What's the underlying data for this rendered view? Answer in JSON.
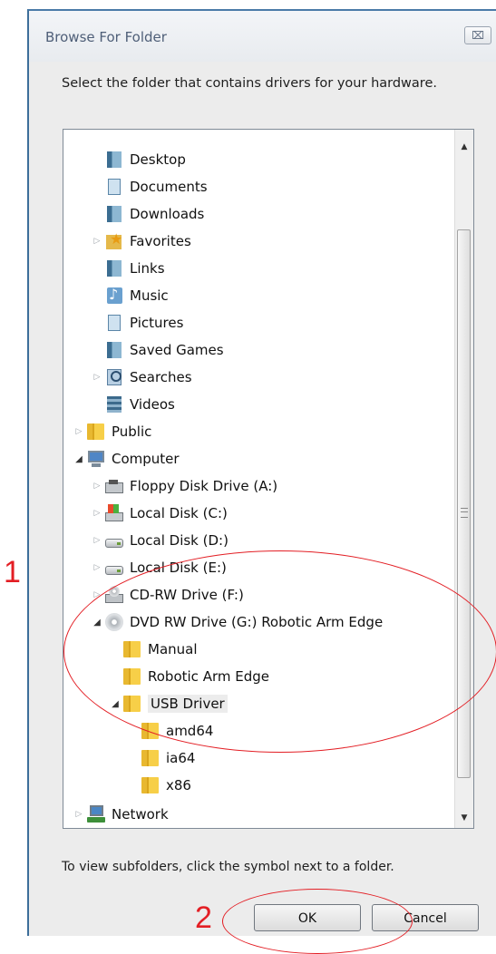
{
  "dialog": {
    "title": "Browse For Folder",
    "close_label": "⌧",
    "instruction": "Select the folder that contains drivers for your hardware.",
    "hint": "To view subfolders, click the symbol next to a folder.",
    "ok_label": "OK",
    "cancel_label": "Cancel"
  },
  "tree": {
    "items": [
      {
        "label": "Desktop",
        "icon": "library-icon"
      },
      {
        "label": "Documents",
        "icon": "documents-icon"
      },
      {
        "label": "Downloads",
        "icon": "library-icon"
      },
      {
        "label": "Favorites",
        "icon": "favorites-icon"
      },
      {
        "label": "Links",
        "icon": "library-icon"
      },
      {
        "label": "Music",
        "icon": "music-icon"
      },
      {
        "label": "Pictures",
        "icon": "documents-icon"
      },
      {
        "label": "Saved Games",
        "icon": "library-icon"
      },
      {
        "label": "Searches",
        "icon": "search-folder-icon"
      },
      {
        "label": "Videos",
        "icon": "video-icon"
      },
      {
        "label": "Public",
        "icon": "folder-icon"
      },
      {
        "label": "Computer",
        "icon": "computer-icon"
      },
      {
        "label": "Floppy Disk Drive (A:)",
        "icon": "floppy-drive-icon"
      },
      {
        "label": "Local Disk (C:)",
        "icon": "system-drive-icon"
      },
      {
        "label": "Local Disk (D:)",
        "icon": "hard-disk-icon"
      },
      {
        "label": "Local Disk (E:)",
        "icon": "hard-disk-icon"
      },
      {
        "label": "CD-RW Drive (F:)",
        "icon": "cd-drive-icon"
      },
      {
        "label": "DVD RW Drive (G:) Robotic Arm Edge",
        "icon": "dvd-drive-icon"
      },
      {
        "label": "Manual",
        "icon": "folder-icon"
      },
      {
        "label": "Robotic Arm Edge",
        "icon": "folder-icon"
      },
      {
        "label": "USB Driver",
        "icon": "folder-icon"
      },
      {
        "label": "amd64",
        "icon": "folder-icon"
      },
      {
        "label": "ia64",
        "icon": "folder-icon"
      },
      {
        "label": "x86",
        "icon": "folder-icon"
      },
      {
        "label": "Network",
        "icon": "network-icon"
      }
    ]
  },
  "annotations": {
    "callout_1": "1",
    "callout_2": "2",
    "highlight_color": "#e31e24"
  }
}
